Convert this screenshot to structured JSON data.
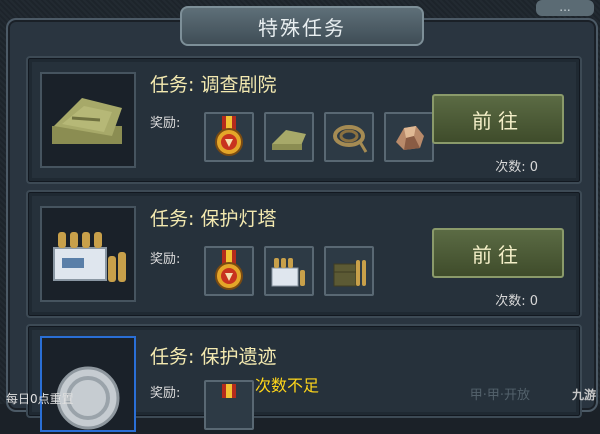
{
  "window": {
    "title": "特殊任务",
    "corner_button": "..."
  },
  "tasks": [
    {
      "title": "任务: 调查剧院",
      "reward_label": "奖励:",
      "button_label": "前往",
      "count_text": "次数: 0",
      "icon": "map-icon",
      "rewards": [
        "medal-icon",
        "map-icon",
        "rope-icon",
        "ore-icon"
      ]
    },
    {
      "title": "任务: 保护灯塔",
      "reward_label": "奖励:",
      "button_label": "前往",
      "count_text": "次数: 0",
      "icon": "ammo-crate-icon",
      "rewards": [
        "medal-icon",
        "ammo-crate-icon",
        "ammo-box-icon"
      ]
    },
    {
      "title": "任务: 保护遗迹",
      "reward_label": "奖励:",
      "button_label": "",
      "count_text": "",
      "icon": "relic-coin-icon",
      "rewards": [
        "medal-icon"
      ]
    }
  ],
  "footer": {
    "reset_note": "每日0点重置",
    "toast": "次数不足",
    "brand": "九游",
    "faded": "甲·甲·开放"
  },
  "colors": {
    "title_text": "#f3e9b0",
    "button_bg": "#5b6b44",
    "toast": "#ffd61a"
  }
}
